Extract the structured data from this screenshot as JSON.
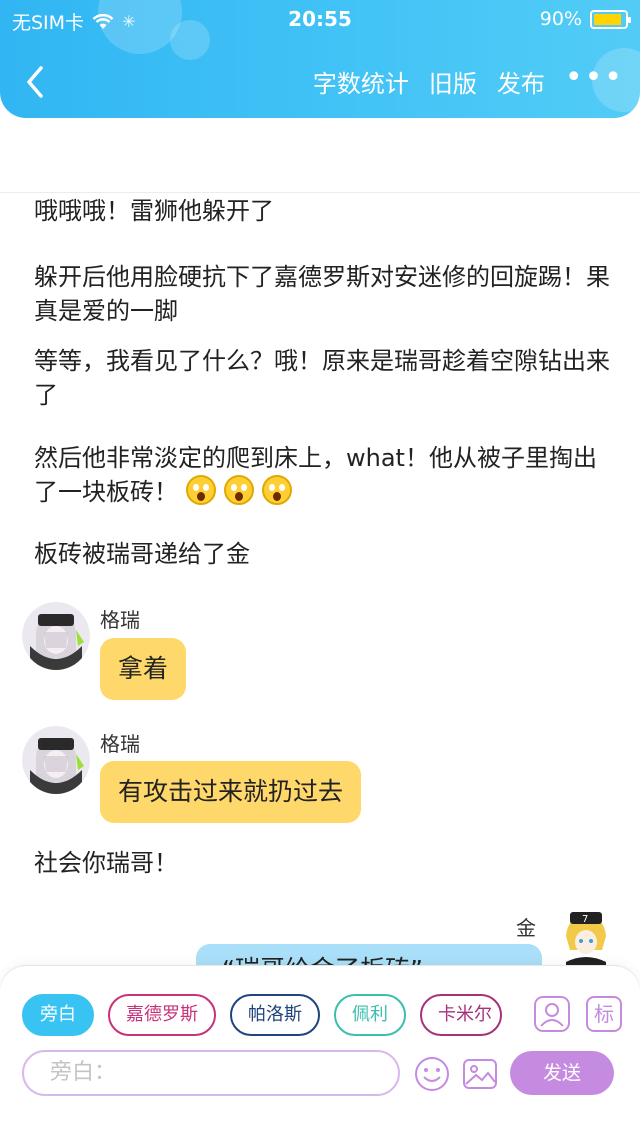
{
  "status_bar": {
    "carrier": "无SIM卡",
    "time": "20:55",
    "battery": "90%",
    "battery_level": 0.9
  },
  "nav": {
    "word_count": "字数统计",
    "old_version": "旧版",
    "publish": "发布",
    "more": "•••"
  },
  "story": {
    "p1": "哦哦哦！雷狮他躲开了",
    "p2": "躲开后他用脸硬抗下了嘉德罗斯对安迷修的回旋踢！果真是爱的一脚",
    "p3": "等等，我看见了什么？哦！原来是瑞哥趁着空隙钻出来了",
    "p4": "然后他非常淡定的爬到床上，what！他从被子里掏出了一块板砖！",
    "p5": "板砖被瑞哥递给了金",
    "p6": "社会你瑞哥！"
  },
  "messages": [
    {
      "speaker": "格瑞",
      "text": "拿着"
    },
    {
      "speaker": "格瑞",
      "text": "有攻击过来就扔过去"
    },
    {
      "speaker": "金",
      "text": "“瑞哥给金了板砖”"
    }
  ],
  "characters": [
    {
      "label": "旁白",
      "color": "#38c3f3"
    },
    {
      "label": "嘉德罗斯",
      "color": "#c8327a"
    },
    {
      "label": "帕洛斯",
      "color": "#20447e"
    },
    {
      "label": "佩利",
      "color": "#3bbfae"
    },
    {
      "label": "卡米尔",
      "color": "#a8327a"
    }
  ],
  "input": {
    "placeholder": "旁白："
  },
  "send_label": "发送",
  "mark_label": "标",
  "colors": {
    "accent": "#38c3f3",
    "purple": "#c58be0",
    "bubble": "#ffd86b"
  }
}
